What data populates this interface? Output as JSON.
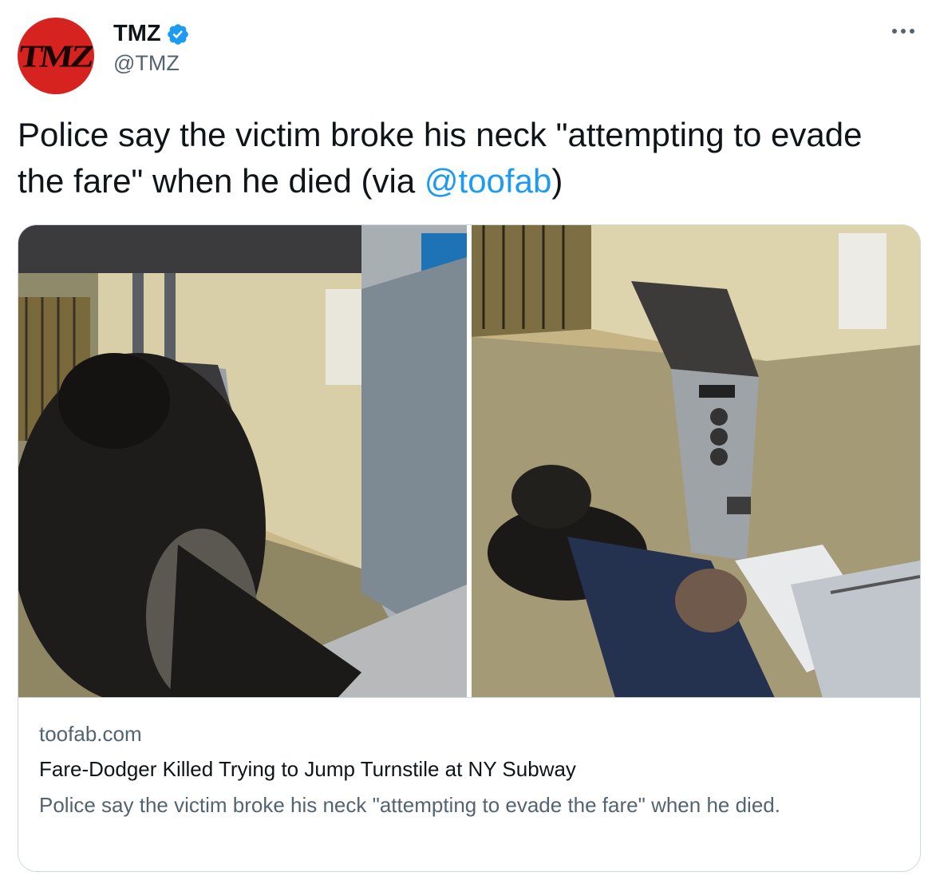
{
  "author": {
    "avatar_text": "TMZ",
    "display_name": "TMZ",
    "handle": "@TMZ",
    "verified": true,
    "avatar_color": "#d6231f"
  },
  "tweet": {
    "text_before": "Police say the victim broke his neck \"attempting to evade the fare\" when he died (via ",
    "mention": "@toofab",
    "text_after": ")"
  },
  "card": {
    "domain": "toofab.com",
    "title": "Fare-Dodger Killed Trying to Jump Turnstile at NY Subway",
    "description": "Police say the victim broke his neck \"attempting to evade the fare\" when he died."
  },
  "icons": {
    "verified": "verified-badge-icon",
    "more": "more-options-icon"
  },
  "colors": {
    "link": "#1d9bf0",
    "secondary_text": "#536471",
    "verified": "#1d9bf0"
  }
}
